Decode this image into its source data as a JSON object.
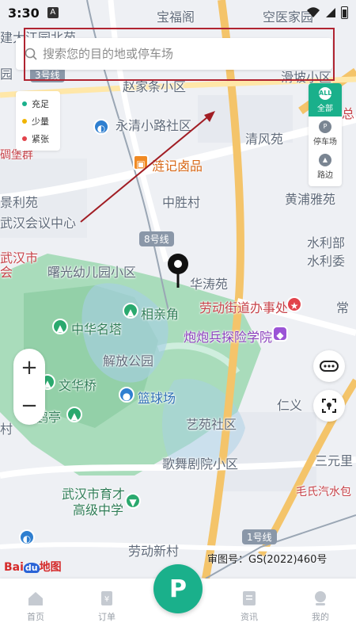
{
  "status_bar": {
    "time": "3:30",
    "notification_badge": "A"
  },
  "search": {
    "placeholder": "搜索您的目的地或停车场"
  },
  "legend": {
    "items": [
      {
        "label": "充足",
        "color": "#1ab08b"
      },
      {
        "label": "少量",
        "color": "#f0b400"
      },
      {
        "label": "紧张",
        "color": "#e2434b"
      }
    ]
  },
  "filter": {
    "items": [
      {
        "label": "全部",
        "icon": "ALL",
        "active": true
      },
      {
        "label": "停车场",
        "icon": "P"
      },
      {
        "label": "路边",
        "icon": "road-icon"
      }
    ]
  },
  "map": {
    "labels": {
      "baofu": "宝福阁",
      "kongyi": "空医家园",
      "jiangang": "建大江园北苑",
      "yuan": "园",
      "zhaojia": "赵家条小区",
      "pinghu": "滑坡小区",
      "yongqing": "永清小路社区",
      "qingfeng": "清风苑",
      "zong": "总",
      "diaobao": "碉堡群",
      "lianji": "涟记卤品",
      "zhongsheng": "中胜村",
      "huangpu": "黄浦雅苑",
      "jingli": "景利苑",
      "huiyi": "武汉会议中心",
      "shuili1": "水利部",
      "shuili2": "水利委",
      "wuhanshi": "武汉市",
      "hui": "会",
      "shuguang": "曙光幼儿园小区",
      "huatao": "华涛苑",
      "laodong_office": "劳动街道办事处",
      "chang": "常",
      "xiangqin": "相亲角",
      "zhonghua": "中华名塔",
      "paopaobing": "炮炮兵探险学院",
      "jiefang": "解放公园",
      "wenhua": "文华桥",
      "lanqiu": "篮球场",
      "renyi": "仁义",
      "he": "鹤亭",
      "cun": "村",
      "yiyuan": "艺苑社区",
      "gewu": "歌舞剧院小区",
      "sanyuan": "三元里",
      "maoshi": "毛氏汽水包",
      "yucai1": "武汉市育才",
      "yucai2": "高级中学",
      "laodong_village": "劳动新村",
      "metro8": "8号线",
      "metro1": "1号线",
      "metro3": "3号线"
    },
    "copyright": "审图号：GS(2022)460号",
    "logo_text": "Bai",
    "logo_du": "du",
    "logo_suffix": "地图"
  },
  "zoom": {
    "in": "+",
    "out": "−"
  },
  "tabbar": {
    "items": [
      {
        "label": "首页"
      },
      {
        "label": "订单"
      },
      {
        "label": "资讯"
      },
      {
        "label": "我的"
      }
    ],
    "center": "P"
  }
}
